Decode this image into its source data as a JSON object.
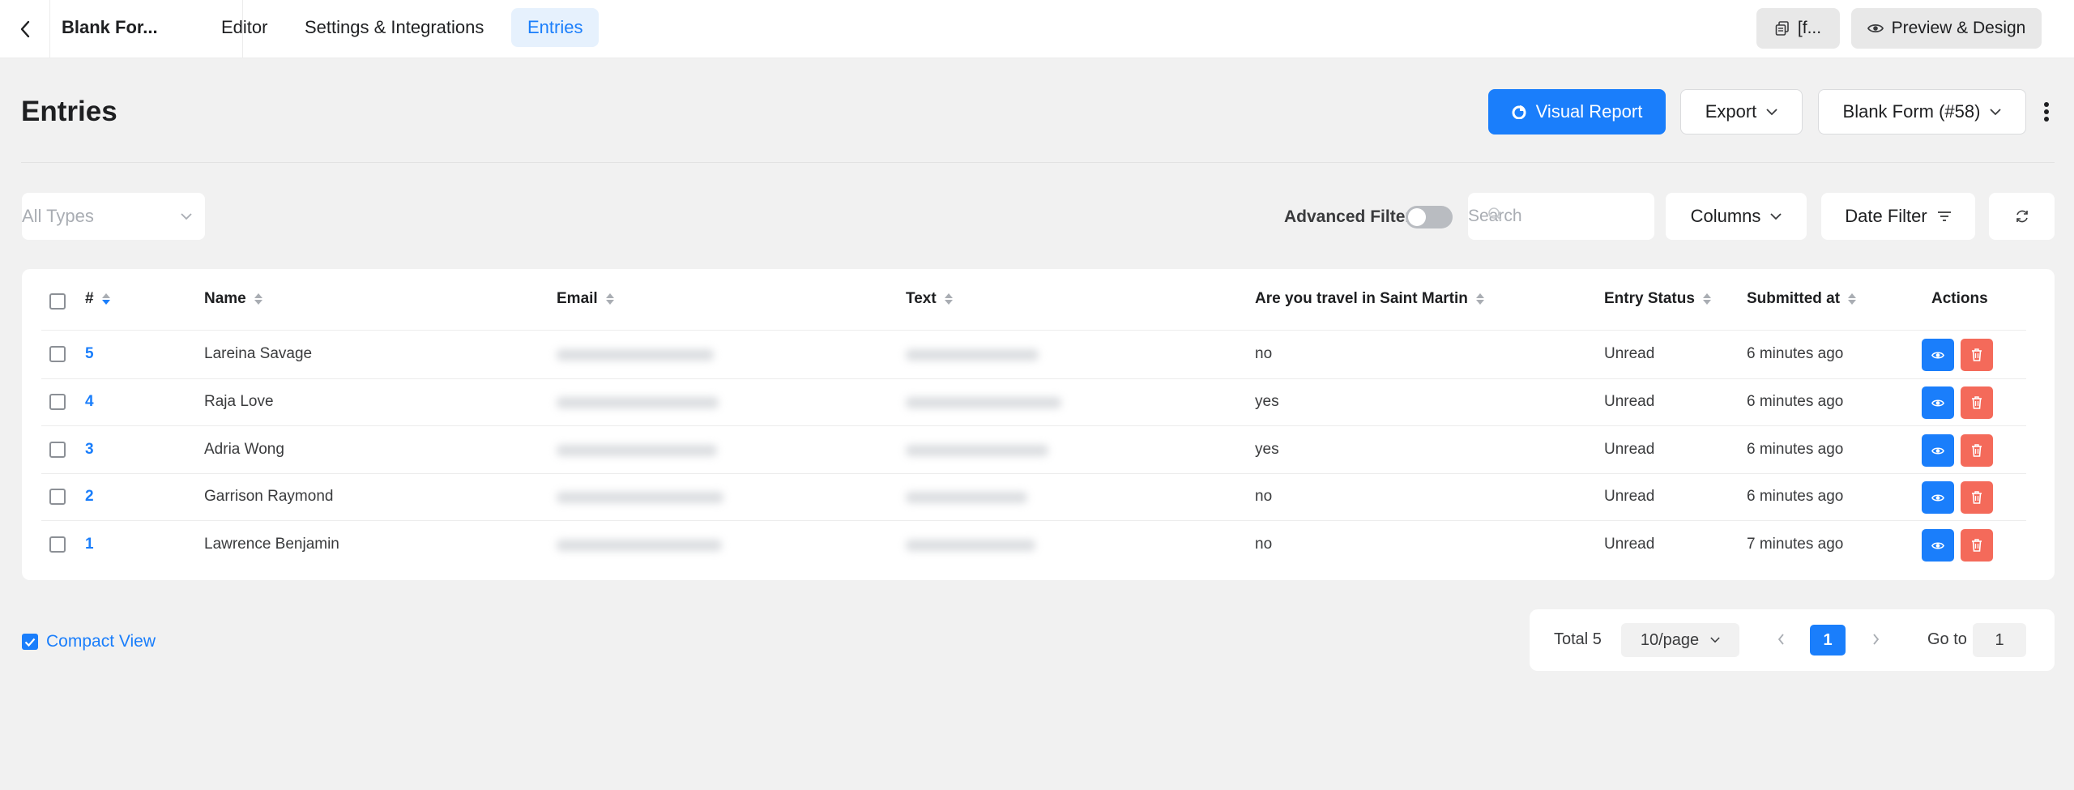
{
  "topbar": {
    "form_title": "Blank For...",
    "tabs": [
      {
        "label": "Editor",
        "active": false
      },
      {
        "label": "Settings & Integrations",
        "active": false
      },
      {
        "label": "Entries",
        "active": true
      }
    ],
    "shortcode_label": "[f...",
    "preview_label": "Preview & Design"
  },
  "header": {
    "title": "Entries",
    "visual_report_label": "Visual Report",
    "export_label": "Export",
    "form_select_label": "Blank Form (#58)"
  },
  "filters": {
    "types_placeholder": "All Types",
    "advanced_filter_label": "Advanced Filter",
    "advanced_filter_on": false,
    "search_placeholder": "Search",
    "columns_label": "Columns",
    "date_filter_label": "Date Filter"
  },
  "table": {
    "columns": [
      "#",
      "Name",
      "Email",
      "Text",
      "Are you travel in Saint Martin",
      "Entry Status",
      "Submitted at",
      "Actions"
    ],
    "rows": [
      {
        "id": "5",
        "name": "Lareina Savage",
        "travel": "no",
        "status": "Unread",
        "submitted": "6 minutes ago"
      },
      {
        "id": "4",
        "name": "Raja Love",
        "travel": "yes",
        "status": "Unread",
        "submitted": "6 minutes ago"
      },
      {
        "id": "3",
        "name": "Adria Wong",
        "travel": "yes",
        "status": "Unread",
        "submitted": "6 minutes ago"
      },
      {
        "id": "2",
        "name": "Garrison Raymond",
        "travel": "no",
        "status": "Unread",
        "submitted": "6 minutes ago"
      },
      {
        "id": "1",
        "name": "Lawrence Benjamin",
        "travel": "no",
        "status": "Unread",
        "submitted": "7 minutes ago"
      }
    ]
  },
  "footer": {
    "compact_view_label": "Compact View",
    "compact_view_checked": true,
    "total_label": "Total 5",
    "page_size_label": "10/page",
    "current_page": "1",
    "goto_label": "Go to",
    "goto_value": "1"
  },
  "colors": {
    "accent": "#1a7efb",
    "danger": "#f46a5a",
    "background": "#f1f1f1"
  }
}
